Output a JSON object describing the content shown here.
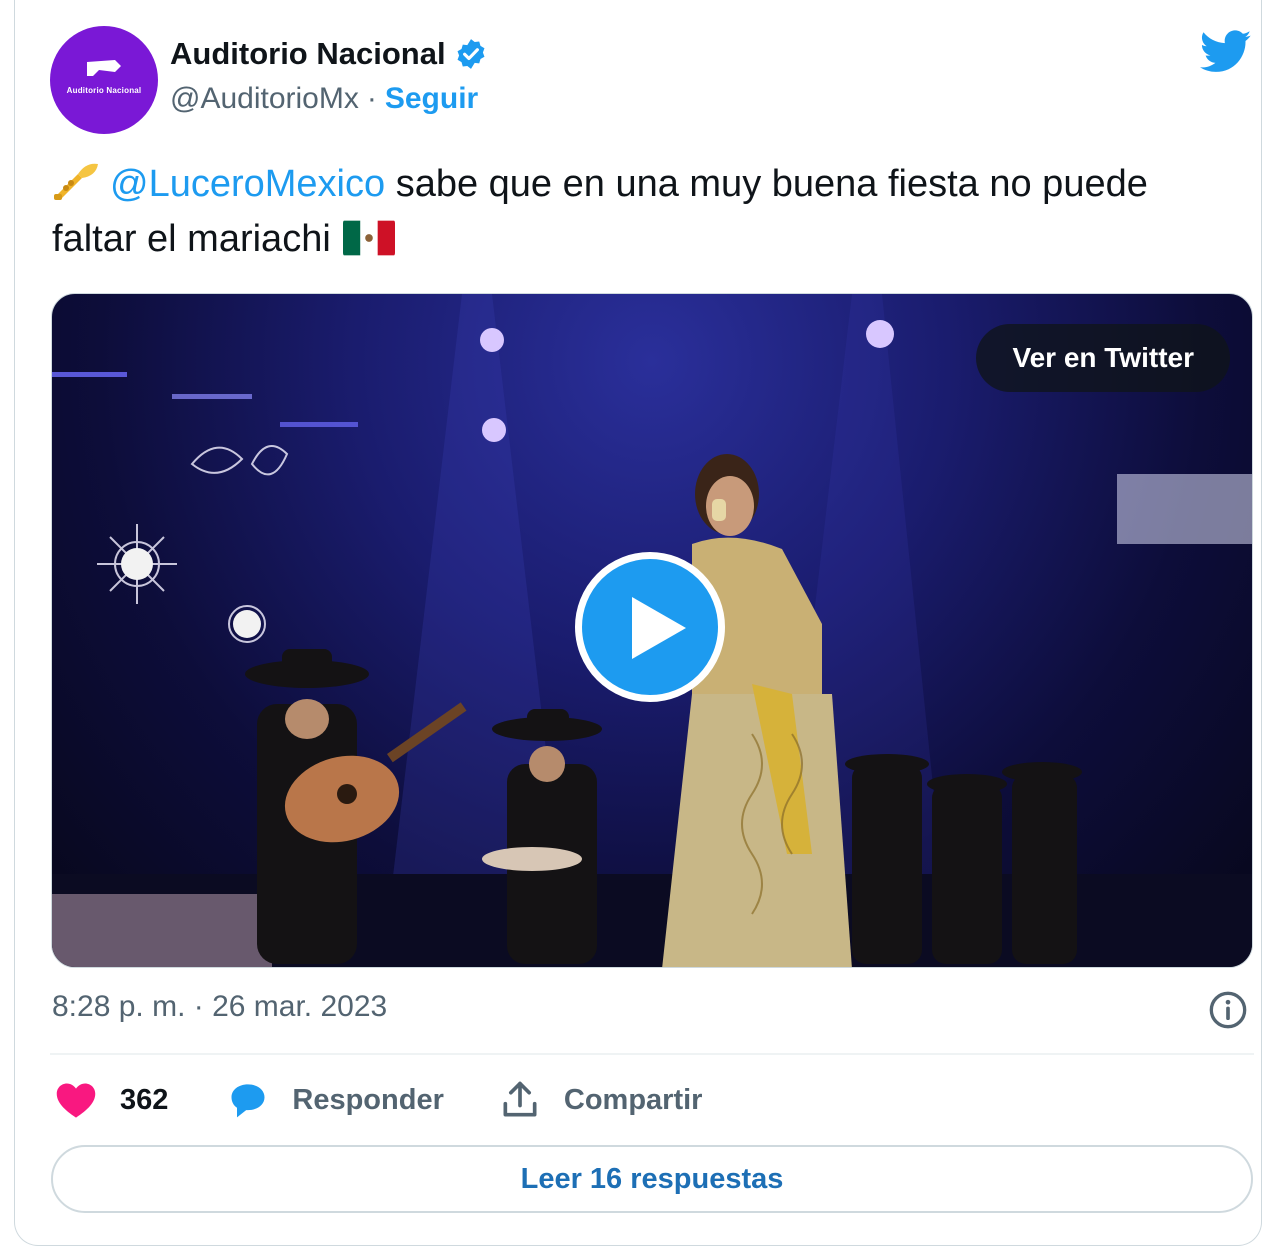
{
  "account": {
    "display_name": "Auditorio Nacional",
    "handle": "@AuditorioMx",
    "separator": "·",
    "follow_label": "Seguir",
    "avatar_text": "Auditorio Nacional",
    "verified": true
  },
  "tweet": {
    "mention": "@LuceroMexico",
    "text_after_mention": " sabe que en una muy buena fiesta no puede faltar el mariachi",
    "leading_emoji": "trumpet",
    "trailing_emoji": "mexico-flag"
  },
  "media": {
    "type": "video",
    "view_on_twitter_label": "Ver en Twitter"
  },
  "meta": {
    "timestamp": "8:28 p. m. · 26 mar. 2023"
  },
  "actions": {
    "like_count": "362",
    "reply_label": "Responder",
    "share_label": "Compartir"
  },
  "read_replies_label": "Leer 16 respuestas",
  "colors": {
    "brand_blue": "#1d9bf0",
    "like_pink": "#f91880",
    "avatar_purple": "#7a18d6",
    "text_primary": "#0f1419",
    "text_secondary": "#536471"
  }
}
